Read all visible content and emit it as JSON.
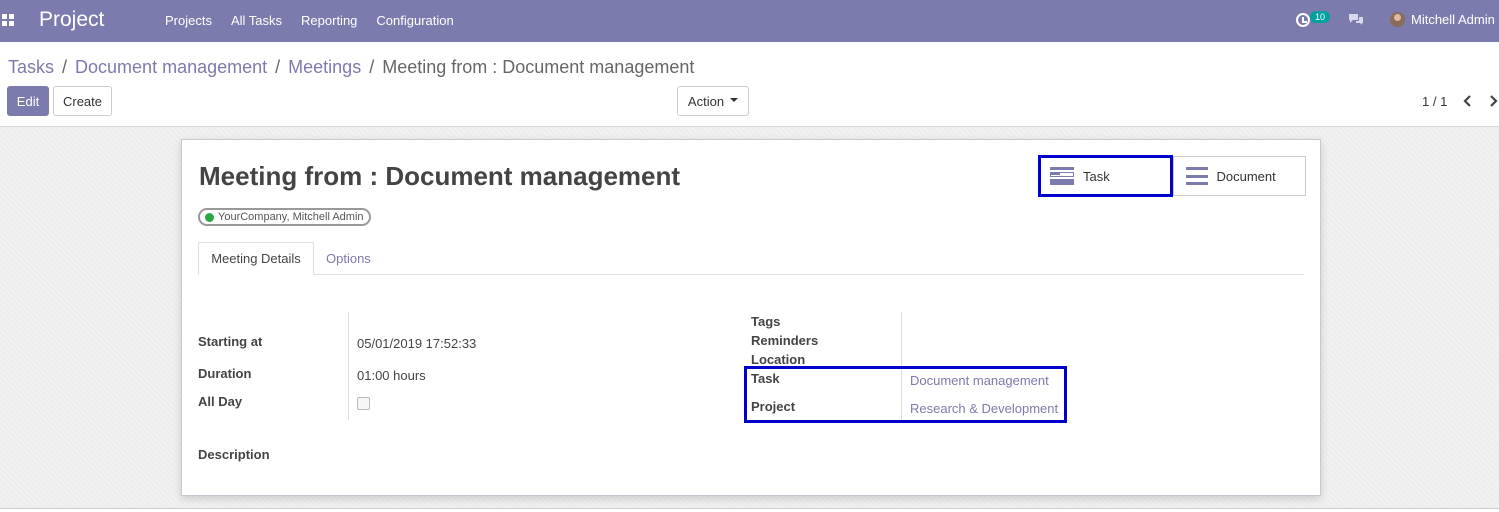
{
  "navbar": {
    "app_name": "Project",
    "menu": [
      "Projects",
      "All Tasks",
      "Reporting",
      "Configuration"
    ],
    "activity_count": "10",
    "user_name": "Mitchell Admin",
    "icons": [
      "apps-icon",
      "clock-icon",
      "chat-icon",
      "avatar"
    ]
  },
  "breadcrumb": {
    "items": [
      "Tasks",
      "Document management",
      "Meetings"
    ],
    "separator": "/",
    "current": "Meeting from : Document management"
  },
  "toolbar": {
    "edit_label": "Edit",
    "create_label": "Create",
    "action_label": "Action"
  },
  "pager": {
    "value": "1 / 1"
  },
  "record": {
    "title": "Meeting from : Document management",
    "attendee_tag": "YourCompany, Mitchell Admin",
    "stat_buttons": {
      "task_label": "Task",
      "document_label": "Document"
    },
    "tabs": [
      "Meeting Details",
      "Options"
    ],
    "left_fields": {
      "starting_at_label": "Starting at",
      "starting_at_value": "05/01/2019 17:52:33",
      "duration_label": "Duration",
      "duration_value": "01:00 hours",
      "all_day_label": "All Day",
      "all_day_checked": false
    },
    "right_fields": {
      "tags_label": "Tags",
      "reminders_label": "Reminders",
      "location_label": "Location",
      "task_label": "Task",
      "task_value": "Document management",
      "project_label": "Project",
      "project_value": "Research & Development"
    },
    "description_label": "Description"
  },
  "colors": {
    "brand": "#7c7bad",
    "highlight": "#0000cc",
    "online_dot": "#28a745",
    "badge": "#00a09d"
  }
}
